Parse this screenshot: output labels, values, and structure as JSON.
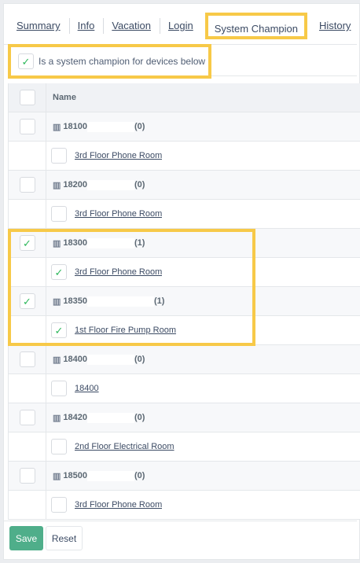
{
  "tabs": [
    {
      "label": "Summary",
      "active": false
    },
    {
      "label": "Info",
      "active": false
    },
    {
      "label": "Vacation",
      "active": false
    },
    {
      "label": "Login",
      "active": false
    },
    {
      "label": "System Champion",
      "active": true
    },
    {
      "label": "History",
      "active": false
    }
  ],
  "champion": {
    "label": "Is a system champion for devices below",
    "checked": true,
    "check_glyph": "✓"
  },
  "table": {
    "header": "Name",
    "rows": [
      {
        "type": "building",
        "code": "18100",
        "count": "(0)",
        "checked": false
      },
      {
        "type": "device",
        "label": "3rd Floor Phone Room",
        "checked": false
      },
      {
        "type": "building",
        "code": "18200",
        "count": "(0)",
        "checked": false
      },
      {
        "type": "device",
        "label": "3rd Floor Phone Room",
        "checked": false
      },
      {
        "type": "building",
        "code": "18300",
        "count": "(1)",
        "checked": true
      },
      {
        "type": "device",
        "label": "3rd Floor Phone Room",
        "checked": true
      },
      {
        "type": "building",
        "code": "18350",
        "count": "(1)",
        "checked": true
      },
      {
        "type": "device",
        "label": "1st Floor Fire Pump Room",
        "checked": true
      },
      {
        "type": "building",
        "code": "18400",
        "count": "(0)",
        "checked": false
      },
      {
        "type": "device",
        "label": "18400",
        "checked": false
      },
      {
        "type": "building",
        "code": "18420",
        "count": "(0)",
        "checked": false
      },
      {
        "type": "device",
        "label": "2nd Floor Electrical Room",
        "checked": false
      },
      {
        "type": "building",
        "code": "18500",
        "count": "(0)",
        "checked": false
      },
      {
        "type": "device",
        "label": "3rd Floor Phone Room",
        "checked": false
      }
    ]
  },
  "buttons": {
    "save": "Save",
    "reset": "Reset"
  },
  "colors": {
    "accent_highlight": "#f7c948",
    "check": "#2eb85c",
    "save_button": "#4fae8a"
  }
}
